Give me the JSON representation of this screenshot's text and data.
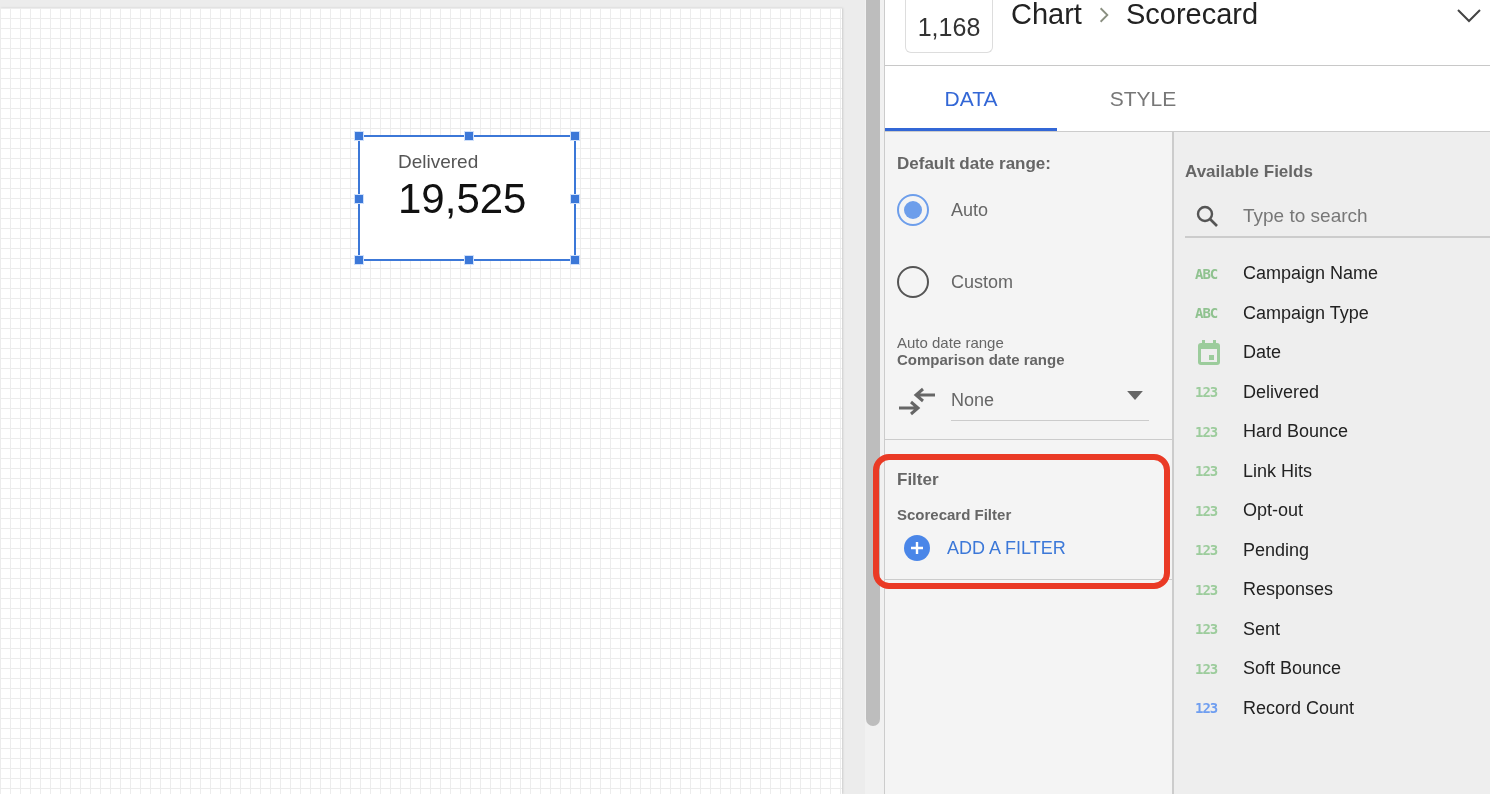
{
  "canvas": {
    "scorecard": {
      "label": "Delivered",
      "value": "19,525",
      "selected": true
    }
  },
  "header": {
    "total": "1,168",
    "breadcrumb": [
      "Chart",
      "Scorecard"
    ]
  },
  "tabs": [
    {
      "label": "DATA",
      "selected": true
    },
    {
      "label": "STYLE",
      "selected": false
    }
  ],
  "date_range": {
    "title": "Default date range:",
    "options": [
      {
        "label": "Auto",
        "selected": true
      },
      {
        "label": "Custom",
        "selected": false
      }
    ],
    "auto_label": "Auto date range",
    "comparison_label": "Comparison date range",
    "comparison_value": "None"
  },
  "filter": {
    "title": "Filter",
    "subtitle": "Scorecard Filter",
    "button": "ADD A FILTER",
    "highlighted": true
  },
  "available_fields": {
    "title": "Available Fields",
    "search_placeholder": "Type to search",
    "fields": [
      {
        "kind": "text",
        "type_label": "ABC",
        "name": "Campaign Name"
      },
      {
        "kind": "text",
        "type_label": "ABC",
        "name": "Campaign Type"
      },
      {
        "kind": "date",
        "name": "Date"
      },
      {
        "kind": "number",
        "type_label": "123",
        "name": "Delivered"
      },
      {
        "kind": "number",
        "type_label": "123",
        "name": "Hard Bounce"
      },
      {
        "kind": "number",
        "type_label": "123",
        "name": "Link Hits"
      },
      {
        "kind": "number",
        "type_label": "123",
        "name": "Opt-out"
      },
      {
        "kind": "number",
        "type_label": "123",
        "name": "Pending"
      },
      {
        "kind": "number",
        "type_label": "123",
        "name": "Responses"
      },
      {
        "kind": "number",
        "type_label": "123",
        "name": "Sent"
      },
      {
        "kind": "number",
        "type_label": "123",
        "name": "Soft Bounce"
      },
      {
        "kind": "count",
        "type_label": "123",
        "name": "Record Count"
      }
    ]
  }
}
